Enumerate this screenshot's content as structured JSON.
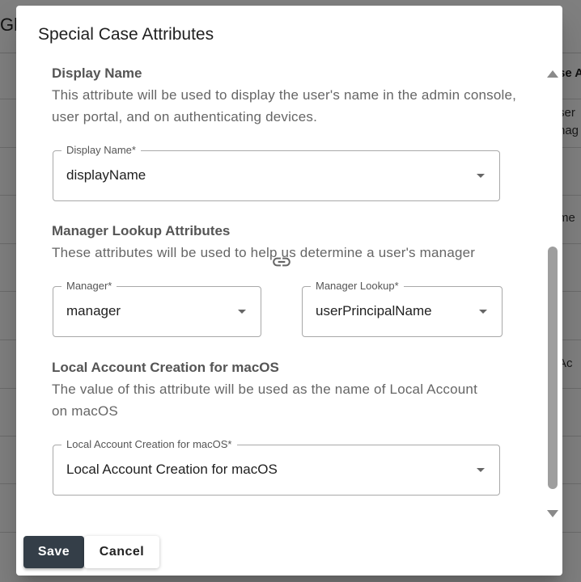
{
  "background": {
    "title_fragment": "Gl",
    "column_header_fragment": "se A",
    "cells": [
      "ser",
      "nag",
      "me",
      "Ac"
    ]
  },
  "dialog": {
    "title": "Special Case Attributes",
    "sections": {
      "display_name": {
        "title": "Display Name",
        "description": "This attribute will be used to display the user's name in the admin console, user portal, and on authenticating devices.",
        "field": {
          "label": "Display Name*",
          "value": "displayName"
        }
      },
      "manager_lookup": {
        "title": "Manager Lookup Attributes",
        "description": "These attributes will be used to help us determine a user's manager",
        "manager_field": {
          "label": "Manager*",
          "value": "manager"
        },
        "lookup_field": {
          "label": "Manager Lookup*",
          "value": "userPrincipalName"
        }
      },
      "local_account": {
        "title": "Local Account Creation for macOS",
        "description": "The value of this attribute will be used as the name of Local Account on macOS",
        "field": {
          "label": "Local Account Creation for macOS*",
          "value": "Local Account Creation for macOS"
        }
      }
    },
    "actions": {
      "save_label": "Save",
      "cancel_label": "Cancel"
    }
  },
  "colors": {
    "primary_button": "#343e48",
    "overlay": "rgba(0,0,0,0.5)"
  }
}
